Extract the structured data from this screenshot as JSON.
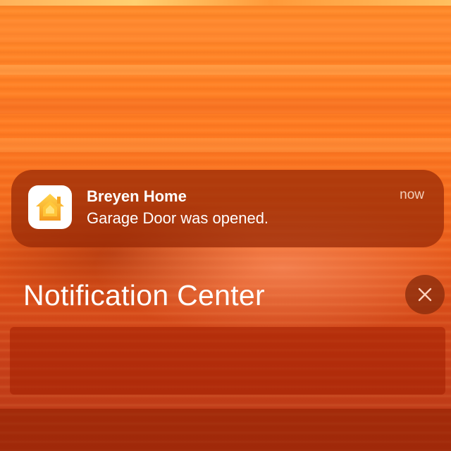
{
  "notification": {
    "app_name": "Breyen Home",
    "message": "Garage Door was opened.",
    "time": "now",
    "app_icon": "home-app-icon"
  },
  "notification_center": {
    "title": "Notification Center",
    "clear_icon": "close-icon"
  },
  "colors": {
    "wallpaper_top": "#ff8a2a",
    "wallpaper_bottom": "#b83816",
    "banner_bg": "#96280599",
    "home_icon_orange": "#f5a623"
  }
}
